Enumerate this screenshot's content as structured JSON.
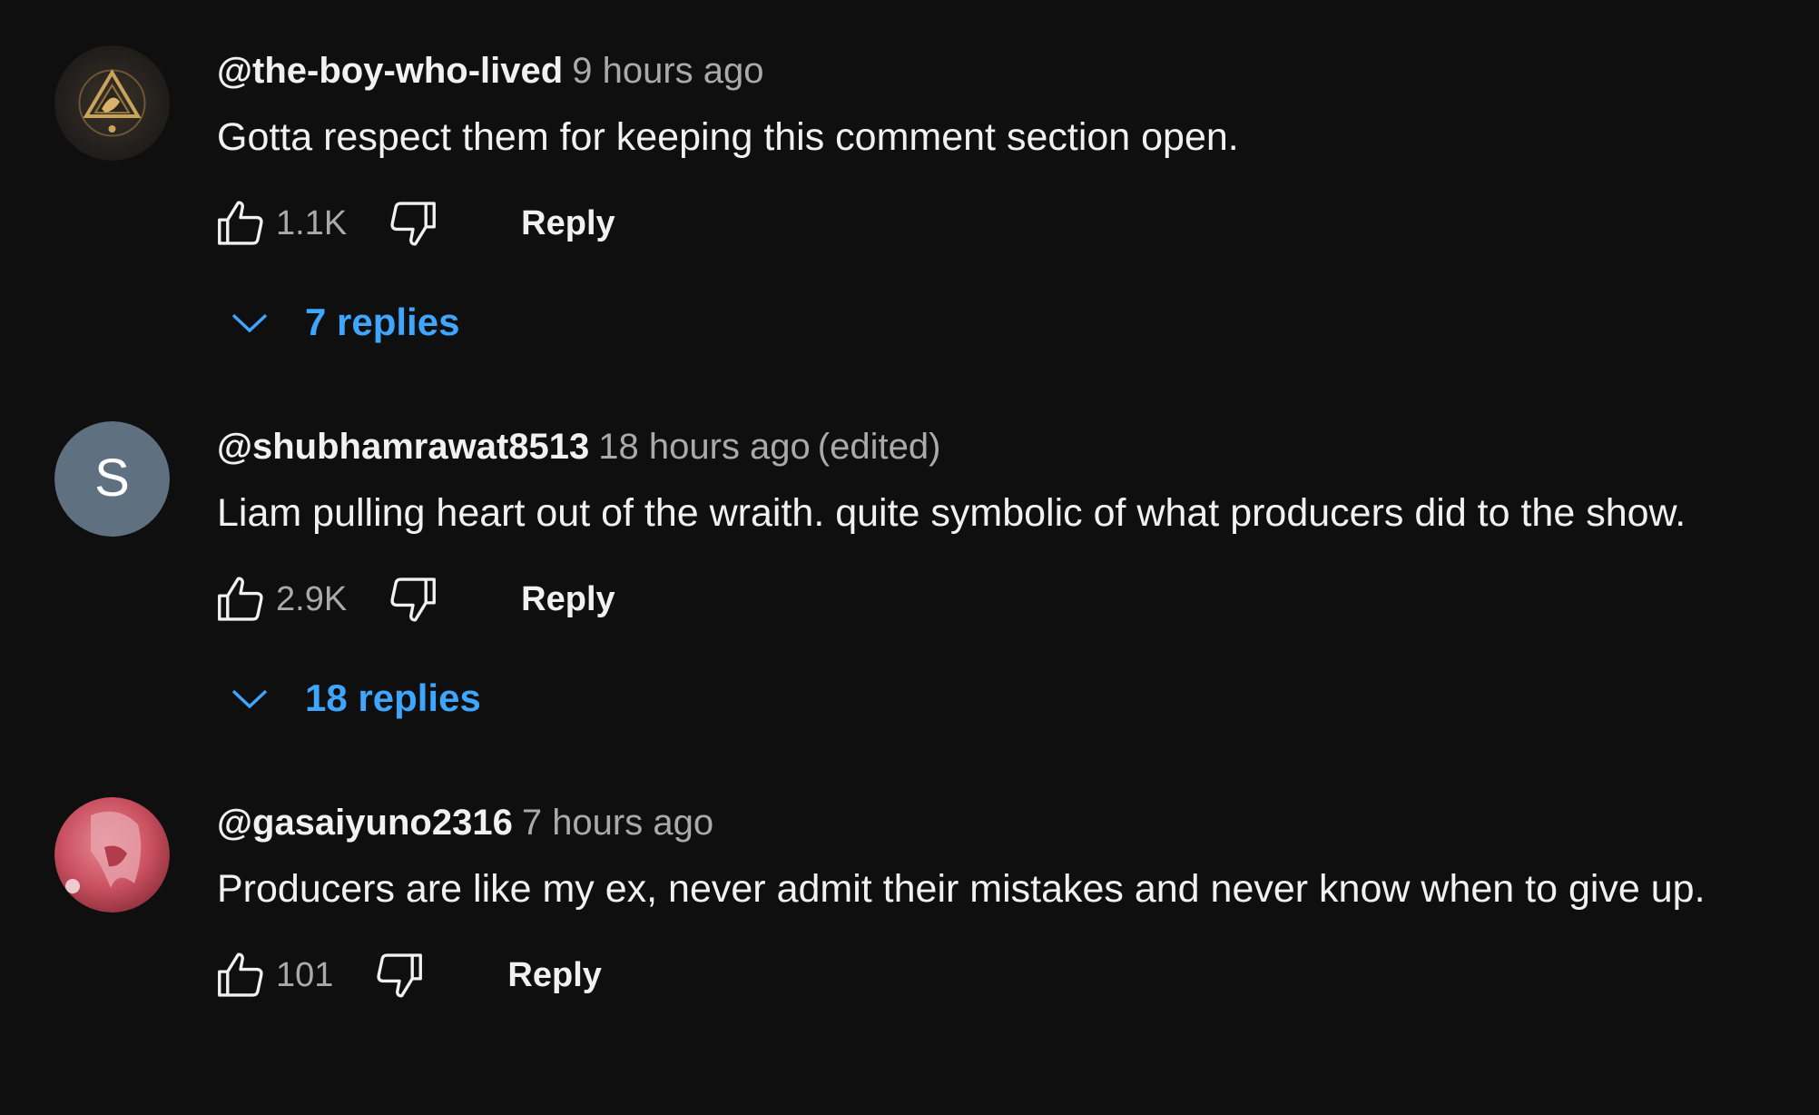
{
  "colors": {
    "background": "#0f0f0f",
    "text_primary": "#f1f1f1",
    "text_secondary": "#aaaaaa",
    "link_blue": "#3ea6ff",
    "avatar_s_bg": "#5f7080"
  },
  "comments": [
    {
      "author": "@the-boy-who-lived",
      "time": "9 hours ago",
      "edited": "",
      "text": "Gotta respect them for keeping this comment section open.",
      "likes": "1.1K",
      "reply_label": "Reply",
      "replies_label": "7 replies",
      "avatar_icon": "gold-emblem-avatar"
    },
    {
      "author": "@shubhamrawat8513",
      "time": "18 hours ago",
      "edited": "(edited)",
      "text": "Liam pulling heart out of the wraith. quite symbolic of what producers did to the show.",
      "likes": "2.9K",
      "reply_label": "Reply",
      "replies_label": "18 replies",
      "avatar_letter": "S"
    },
    {
      "author": "@gasaiyuno2316",
      "time": "7 hours ago",
      "edited": "",
      "text": "Producers are like my ex, never admit their mistakes and never know when to give up.",
      "likes": "101",
      "reply_label": "Reply",
      "avatar_icon": "pink-anime-avatar"
    }
  ]
}
